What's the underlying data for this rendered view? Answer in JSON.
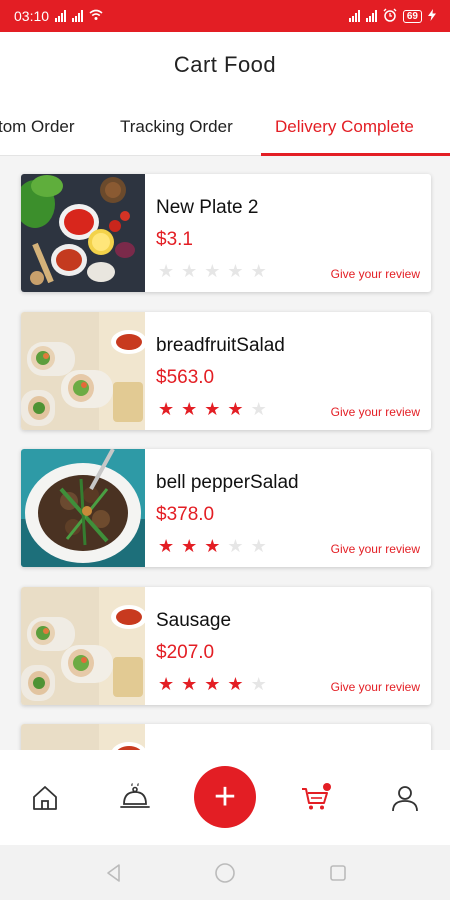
{
  "status_bar": {
    "time": "03:10",
    "battery": "69",
    "left_icons": [
      "signal-icon",
      "signal-icon",
      "wifi-icon"
    ],
    "right_icons": [
      "signal-icon",
      "signal-icon",
      "alarm-icon",
      "battery-icon",
      "charging-icon"
    ]
  },
  "header": {
    "title": "Cart Food"
  },
  "tabs": [
    {
      "label": "tom Order",
      "active": false
    },
    {
      "label": "Tracking Order",
      "active": false
    },
    {
      "label": "Delivery Complete",
      "active": true
    }
  ],
  "orders": [
    {
      "name": "New Plate 2",
      "price": "$3.1",
      "rating": 0,
      "review_label": "Give your review",
      "image": "spice-bowls-photo"
    },
    {
      "name": "breadfruitSalad",
      "price": "$563.0",
      "rating": 4,
      "review_label": "Give your review",
      "image": "spring-rolls-photo"
    },
    {
      "name": "bell pepperSalad",
      "price": "$378.0",
      "rating": 3,
      "review_label": "Give your review",
      "image": "stir-fry-photo"
    },
    {
      "name": "Sausage",
      "price": "$207.0",
      "rating": 4,
      "review_label": "Give your review",
      "image": "spring-rolls-photo"
    },
    {
      "name": "",
      "price": "",
      "rating": 0,
      "review_label": "",
      "image": "spring-rolls-photo"
    }
  ],
  "bottom_nav": {
    "items": [
      "home-icon",
      "food-cloche-icon",
      "add-icon",
      "cart-icon",
      "profile-icon"
    ],
    "fab_label": "+"
  },
  "system_nav": [
    "back-icon",
    "home-circle-icon",
    "recents-icon"
  ],
  "colors": {
    "accent": "#e31e24",
    "star_off": "#e6e6e6",
    "background": "#f4f4f4"
  }
}
